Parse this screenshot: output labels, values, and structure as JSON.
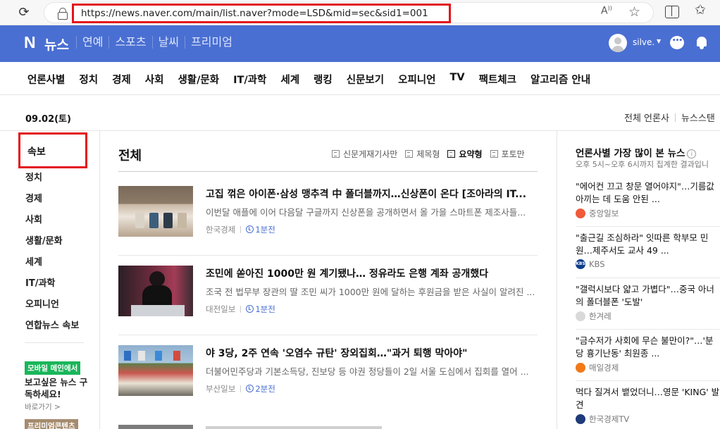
{
  "browser": {
    "url": "https://news.naver.com/main/list.naver?mode=LSD&mid=sec&sid1=001",
    "read_aloud": "A͠",
    "favorite_icon": "star-icon"
  },
  "header": {
    "logo_n": "N",
    "logo_news": "뉴스",
    "nav": [
      "연예",
      "스포츠",
      "날씨",
      "프리미엄"
    ],
    "username": "silve.",
    "brand_color": "#4a6fd2"
  },
  "sections": [
    "언론사별",
    "정치",
    "경제",
    "사회",
    "생활/문화",
    "IT/과학",
    "세계",
    "랭킹",
    "신문보기",
    "오피니언",
    "TV",
    "팩트체크",
    "알고리즘 안내"
  ],
  "date": "09.02(토)",
  "top_links": [
    "전체 언론사",
    "뉴스스탠"
  ],
  "left_nav": {
    "active": "속보",
    "items": [
      "정치",
      "경제",
      "사회",
      "생활/문화",
      "세계",
      "IT/과학",
      "오피니언",
      "연합뉴스 속보"
    ],
    "promo_badge": "모바일 메인에서",
    "promo_text": "보고싶은 뉴스 구독하세요!",
    "promo_link": "바로가기 >",
    "premium_badge": "프리미엄콘텐츠"
  },
  "main": {
    "title": "전체",
    "view_tabs": [
      "신문게재기사만",
      "제목형",
      "요약형",
      "포토만"
    ],
    "active_view": "요약형",
    "articles": [
      {
        "headline": "고집 꺾은 아이폰·삼성 맹추격 中 폴더블까지…신상폰이 온다 [조아라의 IT...",
        "lede": "이번달 애플에 이어 다음달 구글까지 신상폰을 공개하면서 올 가을 스마트폰 제조사들...",
        "press": "한국경제",
        "time": "1분전"
      },
      {
        "headline": "조민에 쏟아진 1000만 원 계기됐나… 정유라도 은행 계좌 공개했다",
        "lede": "조국 전 법무부 장관의 딸 조민 씨가 1000만 원에 달하는 후원금을 받은 사실이 알려진 ...",
        "press": "대전일보",
        "time": "1분전"
      },
      {
        "headline": "야 3당, 2주 연속 '오염수 규탄' 장외집회…\"과거 퇴행 막아야\"",
        "lede": "더불어민주당과 기본소득당, 진보당 등 야권 정당들이 2일 서울 도심에서 집회를 열어 ...",
        "press": "부산일보",
        "time": "2분전"
      }
    ]
  },
  "right": {
    "title": "언론사별 가장 많이 본 뉴스",
    "info_icon": "i",
    "subtitle": "오후 5시~오후 6시까지 집계한 결과입니",
    "items": [
      {
        "title": "\"에어컨 끄고 창문 열어야지\"…기름값 아끼는 데 도움 안된 ...",
        "press": "중앙일보",
        "logo_color": "#f05a3a",
        "logo_text": ""
      },
      {
        "title": "\"출근길 조심하라\" 잇따른 학부모 민원…제주서도 교사 49 ...",
        "press": "KBS",
        "logo_color": "#0d3d8c",
        "logo_text": "KBS"
      },
      {
        "title": "\"갤럭시보다 얇고 가볍다\"…중국 아너의 폴더블폰 '도발'",
        "press": "한겨레",
        "logo_color": "#d9d9d9",
        "logo_text": ""
      },
      {
        "title": "\"금수저가 사회에 무슨 불만이?\"…'분당 흉기난동' 최원종 ...",
        "press": "매일경제",
        "logo_color": "#f07a1a",
        "logo_text": ""
      },
      {
        "title": "먹다 질겨서 뱉었더니…영문 'KING' 발견",
        "press": "한국경제TV",
        "logo_color": "#1f3b7a",
        "logo_text": ""
      }
    ]
  }
}
